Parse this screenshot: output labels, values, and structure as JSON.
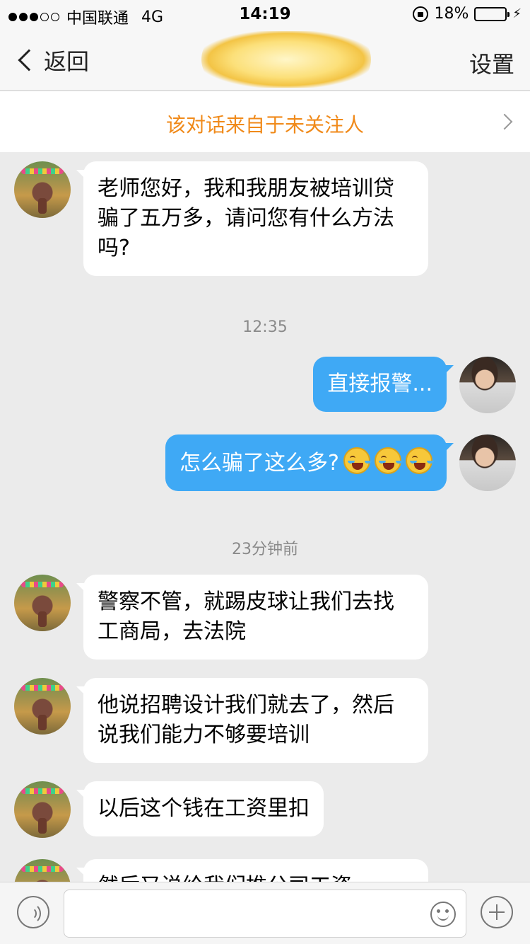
{
  "status_bar": {
    "carrier": "中国联通",
    "network": "4G",
    "time": "14:19",
    "battery_text": "18%",
    "battery_level": 0.18
  },
  "nav": {
    "back_label": "返回",
    "settings_label": "设置"
  },
  "banner": {
    "text": "该对话来自于未关注人"
  },
  "messages": [
    {
      "text": "老师您好，我和我朋友被培训贷骗了五万多，请问您有什么方法吗?"
    },
    {
      "text": "12:35"
    },
    {
      "text": "直接报警..."
    },
    {
      "text": "怎么骗了这么多?"
    },
    {
      "text": "23分钟前"
    },
    {
      "text": "警察不管，就踢皮球让我们去找工商局，去法院"
    },
    {
      "text": "他说招聘设计我们就去了，然后说我们能力不够要培训"
    },
    {
      "text": "以后这个钱在工资里扣"
    },
    {
      "text": "然后又说给我们推公司工资"
    }
  ],
  "input": {
    "placeholder": ""
  }
}
